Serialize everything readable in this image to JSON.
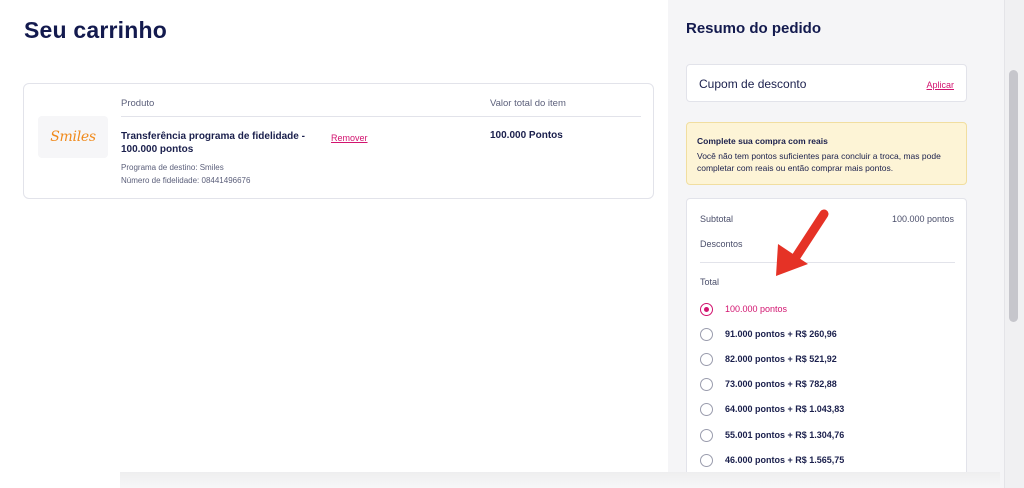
{
  "cart": {
    "title": "Seu carrinho",
    "columns": {
      "product": "Produto",
      "total": "Valor total do item"
    },
    "item": {
      "logo_text": "Smiles",
      "name": "Transferência programa de fidelidade - 100.000 pontos",
      "remove_label": "Remover",
      "total": "100.000 Pontos",
      "destination": "Programa de destino: Smiles",
      "fidelity": "Número de fidelidade: 08441496676"
    }
  },
  "summary": {
    "title": "Resumo do pedido",
    "coupon": {
      "label": "Cupom de desconto",
      "apply_label": "Aplicar"
    },
    "warning": {
      "title": "Complete sua compra com reais",
      "text": "Você não tem pontos suficientes para concluir a troca, mas pode completar com reais ou então comprar mais pontos."
    },
    "subtotal_label": "Subtotal",
    "subtotal_value": "100.000 pontos",
    "discounts_label": "Descontos",
    "total_label": "Total",
    "options": [
      {
        "label": "100.000 pontos",
        "selected": true
      },
      {
        "label": "91.000 pontos + R$ 260,96",
        "selected": false
      },
      {
        "label": "82.000 pontos + R$ 521,92",
        "selected": false
      },
      {
        "label": "73.000 pontos + R$ 782,88",
        "selected": false
      },
      {
        "label": "64.000 pontos + R$ 1.043,83",
        "selected": false
      },
      {
        "label": "55.001 pontos + R$ 1.304,76",
        "selected": false
      },
      {
        "label": "46.000 pontos + R$ 1.565,75",
        "selected": false
      }
    ]
  },
  "colors": {
    "brand_pink": "#d2136f",
    "navy": "#131a4e",
    "warning_bg": "#fdf4d6",
    "annotation_arrow": "#e53226",
    "smiles_orange": "#f08a1c"
  },
  "icons": {
    "annotation": "red-arrow-icon",
    "logo": "smiles-logo"
  }
}
